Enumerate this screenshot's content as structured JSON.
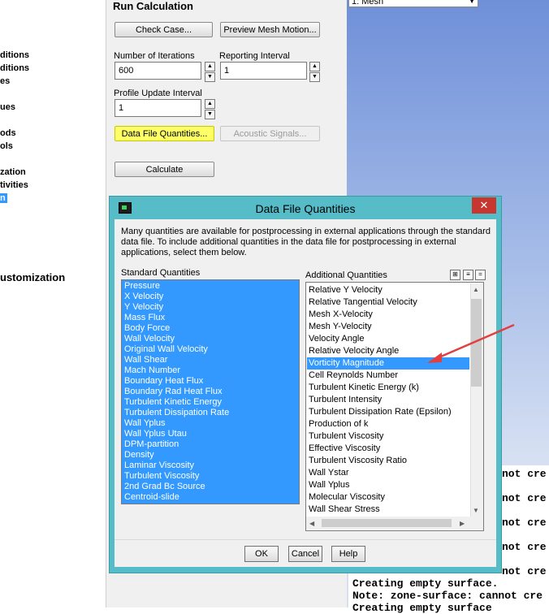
{
  "tree": {
    "items": [
      "ditions",
      "ditions",
      "es",
      "ues",
      "ods",
      "ols",
      "zation",
      "tivities",
      "n"
    ],
    "customization": "ustomization"
  },
  "run_calc": {
    "title": "Run Calculation",
    "check_case": "Check Case...",
    "preview_mesh": "Preview Mesh Motion...",
    "num_iter_label": "Number of Iterations",
    "num_iter_value": "600",
    "report_label": "Reporting Interval",
    "report_value": "1",
    "profile_label": "Profile Update Interval",
    "profile_value": "1",
    "data_file_btn": "Data File Quantities...",
    "acoustic_btn": "Acoustic Signals...",
    "calculate_btn": "Calculate"
  },
  "viewport": {
    "mesh_select": "1: Mesh",
    "console_lines": [
      "not cre",
      "not cre",
      "not cre",
      "not cre",
      "not cre",
      "Creating empty surface.",
      "Note: zone-surface: cannot cre",
      "Creating empty surface"
    ]
  },
  "dialog": {
    "title": "Data File Quantities",
    "close": "✕",
    "description": "Many quantities are available for postprocessing in external applications through the standard data file. To include additional quantities in the data file for postprocessing in external applications, select them below.",
    "std_label": "Standard Quantities",
    "add_label": "Additional Quantities",
    "standard": [
      "Pressure",
      "X Velocity",
      "Y Velocity",
      "Mass Flux",
      "Body Force",
      "Wall Velocity",
      "Original Wall Velocity",
      "Wall Shear",
      "Mach Number",
      "Boundary Heat Flux",
      "Boundary Rad Heat Flux",
      "Turbulent Kinetic Energy",
      "Turbulent Dissipation Rate",
      "Wall Yplus",
      "Wall Yplus Utau",
      "DPM-partition",
      "Density",
      "Laminar Viscosity",
      "Turbulent Viscosity",
      "2nd Grad Bc Source",
      "Centroid-slide"
    ],
    "additional": [
      "Relative Y Velocity",
      "Relative Tangential Velocity",
      "Mesh X-Velocity",
      "Mesh Y-Velocity",
      "Velocity Angle",
      "Relative Velocity Angle",
      "Vorticity Magnitude",
      "Cell Reynolds Number",
      "Turbulent Kinetic Energy (k)",
      "Turbulent Intensity",
      "Turbulent Dissipation Rate (Epsilon)",
      "Production of k",
      "Turbulent Viscosity",
      "Effective Viscosity",
      "Turbulent Viscosity Ratio",
      "Wall Ystar",
      "Wall Yplus",
      "Molecular Viscosity",
      "Wall Shear Stress"
    ],
    "selected_additional": "Vorticity Magnitude",
    "ok": "OK",
    "cancel": "Cancel",
    "help": "Help"
  },
  "colors": {
    "selection": "#3399ff",
    "highlight_button": "#ffff66",
    "dialog_frame": "#55bcc8",
    "close_button": "#c7362f",
    "annotation_arrow": "#e04040"
  }
}
